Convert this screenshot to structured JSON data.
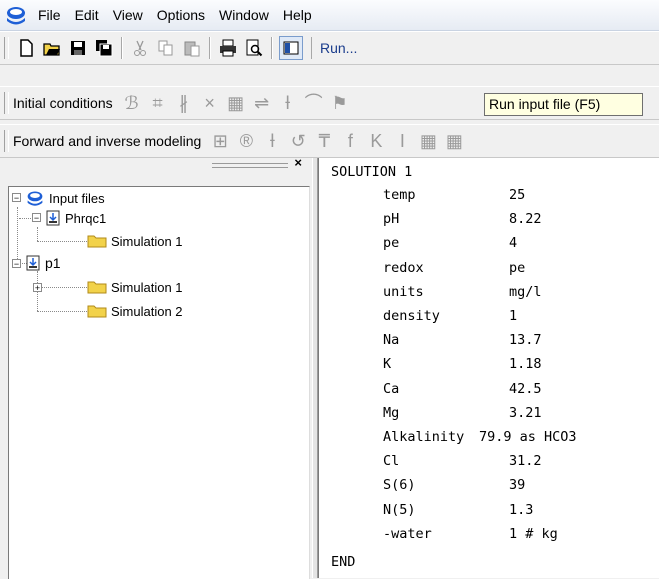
{
  "menu": {
    "items": [
      "File",
      "Edit",
      "View",
      "Options",
      "Window",
      "Help"
    ]
  },
  "toolbar_main": {
    "run_label": "Run..."
  },
  "toolbar_initial": {
    "label": "Initial conditions"
  },
  "toolbar_forward": {
    "label": "Forward and inverse modeling"
  },
  "tooltip": {
    "text": "Run input file (F5)"
  },
  "tree": {
    "root": "Input files",
    "files": [
      {
        "name": "Phrqc1",
        "children": [
          "Simulation 1"
        ]
      },
      {
        "name": "p1",
        "children": [
          "Simulation 1",
          "Simulation 2"
        ]
      }
    ]
  },
  "editor": {
    "header": "SOLUTION 1",
    "rows": [
      {
        "key": "temp",
        "value": "25"
      },
      {
        "key": "pH",
        "value": "8.22"
      },
      {
        "key": "pe",
        "value": "4"
      },
      {
        "key": "redox",
        "value": "pe"
      },
      {
        "key": "units",
        "value": "mg/l"
      },
      {
        "key": "density",
        "value": "1"
      },
      {
        "key": "Na",
        "value": "13.7"
      },
      {
        "key": "K",
        "value": "1.18"
      },
      {
        "key": "Ca",
        "value": "42.5"
      },
      {
        "key": "Mg",
        "value": "3.21"
      },
      {
        "key": "Alkalinity",
        "value": "79.9 as HCO3"
      },
      {
        "key": "Cl",
        "value": "31.2"
      },
      {
        "key": "S(6)",
        "value": "39"
      },
      {
        "key": "N(5)",
        "value": "1.3"
      },
      {
        "key": "-water",
        "value": "1 # kg"
      }
    ],
    "footer": "END"
  },
  "colors": {
    "tooltip_bg": "#ffffe1",
    "app_icon_blue": "#1e5fd6",
    "folder_yellow": "#f2d24a"
  },
  "glyphs": {
    "initial": [
      "ℬ",
      "⌗",
      "∦",
      "×",
      "▦",
      "⇌",
      "Ɨ",
      "⌒",
      "⚑"
    ],
    "forward": [
      "⊞",
      "®",
      "Ɨ",
      "↺",
      "₸",
      "f",
      "K",
      "I",
      "▦",
      "▦"
    ]
  }
}
